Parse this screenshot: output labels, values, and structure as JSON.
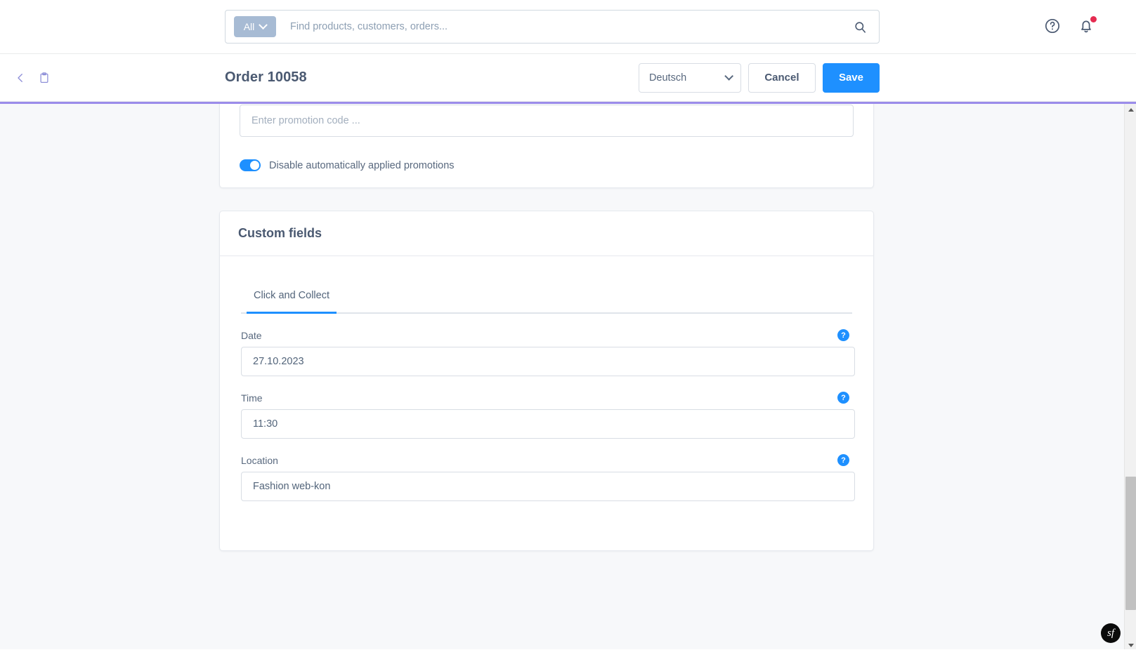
{
  "topbar": {
    "scope_label": "All",
    "scope_icon": "chevron-down-icon",
    "search_placeholder": "Find products, customers, orders...",
    "search_value": "",
    "search_icon": "search-icon",
    "help_icon": "question-circle-icon",
    "notifications_icon": "bell-icon",
    "has_notification": true
  },
  "smartbar": {
    "back_icon": "chevron-left-icon",
    "module_icon": "clipboard-icon",
    "title": "Order 10058",
    "language_value": "Deutsch",
    "language_icon": "chevron-down-icon",
    "cancel_label": "Cancel",
    "save_label": "Save"
  },
  "promotions_card": {
    "promo_placeholder": "Enter promotion code ...",
    "promo_value": "",
    "toggle_label": "Disable automatically applied promotions",
    "toggle_on": true
  },
  "custom_fields_card": {
    "title": "Custom fields",
    "tabs": [
      {
        "label": "Click and Collect",
        "active": true
      }
    ],
    "fields": [
      {
        "label": "Date",
        "value": "27.10.2023",
        "help_icon": "question-circle-icon"
      },
      {
        "label": "Time",
        "value": "11:30",
        "help_icon": "question-circle-icon"
      },
      {
        "label": "Location",
        "value": "Fashion web-kon",
        "help_icon": "question-circle-icon"
      }
    ],
    "help_glyph": "?"
  },
  "scrollbar": {
    "up_icon": "triangle-up-icon",
    "down_icon": "triangle-down-icon"
  },
  "debug_toolbar": {
    "logo_label": "sf"
  },
  "colors": {
    "accent_blue": "#1e90ff",
    "notification_red": "#e52b50",
    "debug_purple": "#9b8cea",
    "text_dark": "#4a5971",
    "text_muted": "#58687e"
  }
}
